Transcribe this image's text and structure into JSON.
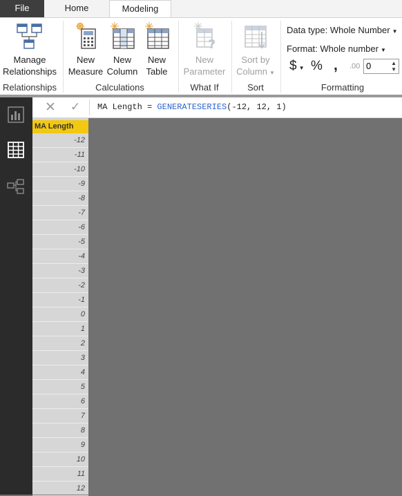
{
  "tabs": {
    "file": "File",
    "home": "Home",
    "modeling": "Modeling"
  },
  "ribbon": {
    "manage_relationships": {
      "line1": "Manage",
      "line2": "Relationships"
    },
    "new_measure": {
      "line1": "New",
      "line2": "Measure"
    },
    "new_column": {
      "line1": "New",
      "line2": "Column"
    },
    "new_table": {
      "line1": "New",
      "line2": "Table"
    },
    "new_parameter": {
      "line1": "New",
      "line2": "Parameter"
    },
    "sort_by_column": {
      "line1": "Sort by",
      "line2": "Column"
    },
    "groups": {
      "relationships": "Relationships",
      "calculations": "Calculations",
      "what_if": "What If",
      "sort": "Sort",
      "formatting": "Formatting"
    },
    "data_type": "Data type: Whole Number",
    "format": "Format: Whole number",
    "currency_symbol": "$",
    "percent_symbol": "%",
    "comma_symbol": ",",
    "decimals_icon_label": ".00",
    "decimal_places": "0"
  },
  "formula_bar": {
    "prefix": "MA Length = ",
    "function": "GENERATESERIES",
    "args": "(-12, 12, 1)"
  },
  "table": {
    "column_header": "MA Length",
    "rows": [
      "-12",
      "-11",
      "-10",
      "-9",
      "-8",
      "-7",
      "-6",
      "-5",
      "-4",
      "-3",
      "-2",
      "-1",
      "0",
      "1",
      "2",
      "3",
      "4",
      "5",
      "6",
      "7",
      "8",
      "9",
      "10",
      "11",
      "12"
    ]
  }
}
